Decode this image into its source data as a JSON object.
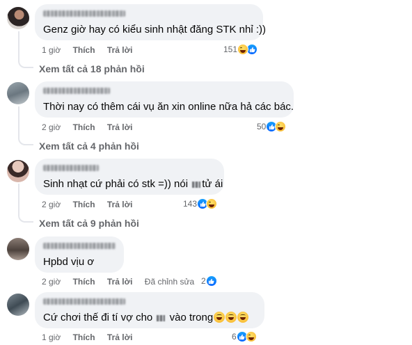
{
  "comments": [
    {
      "text": "Genz giờ hay có kiểu sinh nhật đăng STK nhỉ :))",
      "time": "1 giờ",
      "like_label": "Thích",
      "reply_label": "Trả lời",
      "reaction_count": "151",
      "reactions": [
        "haha-icon",
        "like-icon"
      ],
      "replies_link": "Xem tất cả 18 phản hồi"
    },
    {
      "text": "Thời nay có thêm cái vụ ăn xin online nữa hả các bác.",
      "time": "2 giờ",
      "like_label": "Thích",
      "reply_label": "Trả lời",
      "reaction_count": "50",
      "reactions": [
        "like-icon",
        "haha-icon"
      ],
      "replies_link": "Xem tất cả 4 phản hồi"
    },
    {
      "text_before": "Sinh nhạt cứ phải có stk =)) nói",
      "text_after": "tử ái",
      "time": "2 giờ",
      "like_label": "Thích",
      "reply_label": "Trả lời",
      "reaction_count": "143",
      "reactions": [
        "like-icon",
        "haha-icon"
      ],
      "replies_link": "Xem tất cả 9 phản hồi"
    },
    {
      "text": "Hpbd vịu ơ",
      "time": "2 giờ",
      "like_label": "Thích",
      "reply_label": "Trả lời",
      "edited_label": "Đã chỉnh sửa",
      "reaction_count": "2",
      "reactions": [
        "like-icon"
      ]
    },
    {
      "text_before": "Cứ chơi thế đi tí vợ cho",
      "text_after": "vào trong",
      "time": "1 giờ",
      "like_label": "Thích",
      "reply_label": "Trả lời",
      "reaction_count": "6",
      "reactions": [
        "like-icon",
        "haha-icon"
      ]
    }
  ],
  "colors": {
    "bubble_bg": "#f0f2f5",
    "meta_text": "#65676b",
    "like_blue": "#0866ff",
    "haha_yellow": "#f7b125"
  }
}
